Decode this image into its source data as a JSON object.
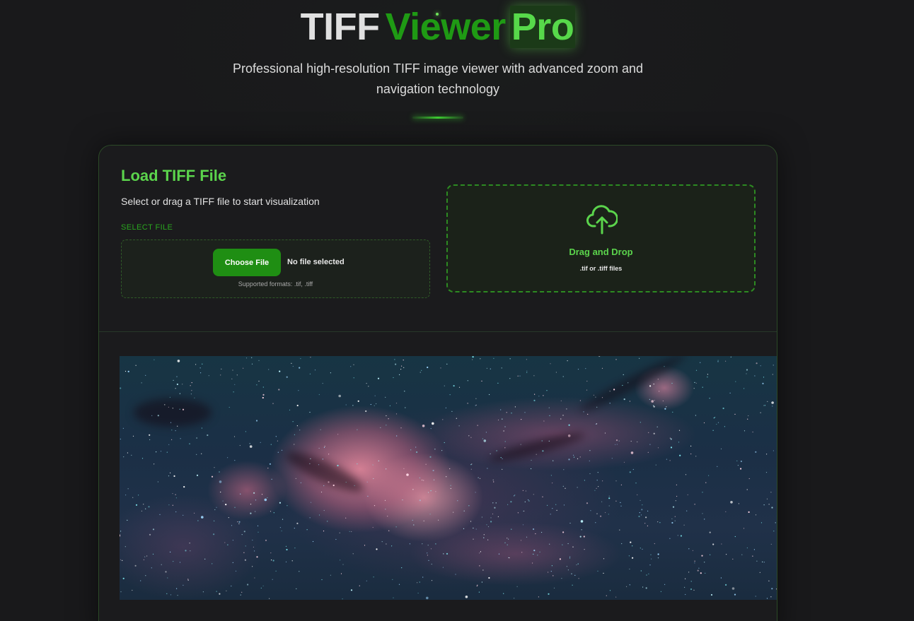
{
  "header": {
    "title_part1": "TIFF",
    "title_part2": "Viewer",
    "title_part3": "Pro",
    "subtitle": "Professional high-resolution TIFF image viewer with advanced zoom and navigation technology"
  },
  "load_panel": {
    "title": "Load TIFF File",
    "description": "Select or drag a TIFF file to start visualization",
    "select_label": "SELECT FILE",
    "choose_button": "Choose File",
    "file_status": "No file selected",
    "supported_formats": "Supported formats: .tif, .tiff"
  },
  "drop_zone": {
    "icon": "cloud-upload-icon",
    "title": "Drag and Drop",
    "subtitle": ".tif or .tiff files"
  },
  "viewer": {
    "image_subject": "nebula-starfield"
  },
  "colors": {
    "background": "#19191b",
    "accent_green": "#5bd44c",
    "button_green": "#1f8e13",
    "title_gray": "#e0e0e0"
  }
}
